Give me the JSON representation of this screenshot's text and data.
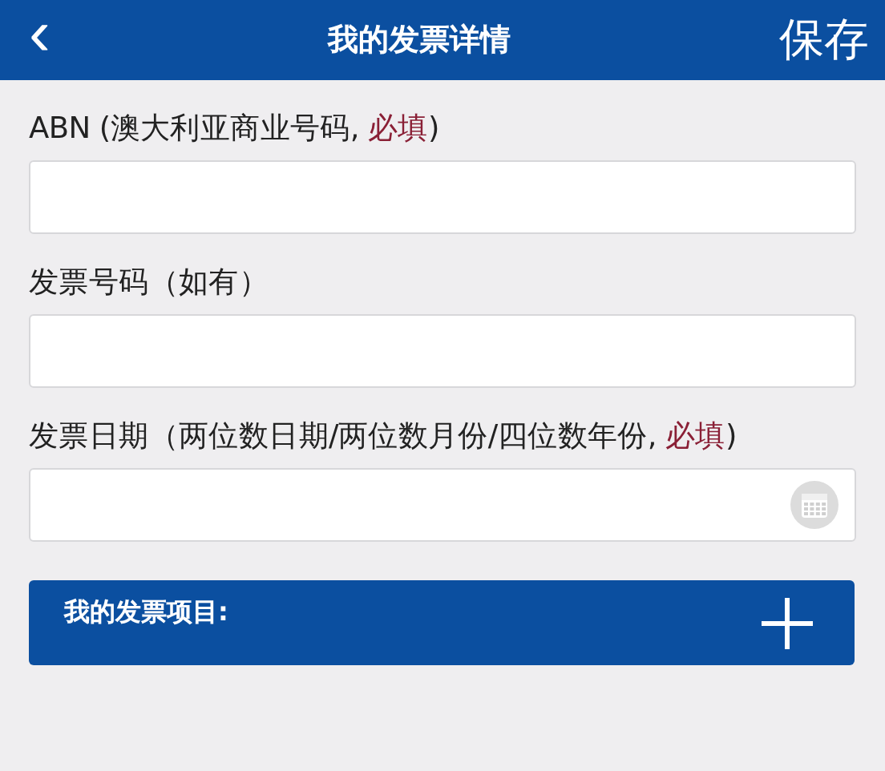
{
  "header": {
    "back": "‹",
    "title": "我的发票详情",
    "save": "保存"
  },
  "fields": [
    {
      "kind": "text",
      "label": [
        {
          "kind": "plain",
          "text": "ABN (澳大利亚商业号码, "
        },
        {
          "kind": "required",
          "text": "必填"
        },
        {
          "kind": "plain",
          "text": ")"
        }
      ]
    },
    {
      "kind": "text",
      "label": [
        {
          "kind": "plain",
          "text": "发票号码（如有）"
        }
      ]
    },
    {
      "kind": "date",
      "label": [
        {
          "kind": "plain",
          "text": "发票日期（两位数日期/两位数月份/四位数年份, "
        },
        {
          "kind": "required",
          "text": "必填"
        },
        {
          "kind": "plain",
          "text": ")"
        }
      ]
    }
  ],
  "section": {
    "title": "我的发票项目:"
  }
}
